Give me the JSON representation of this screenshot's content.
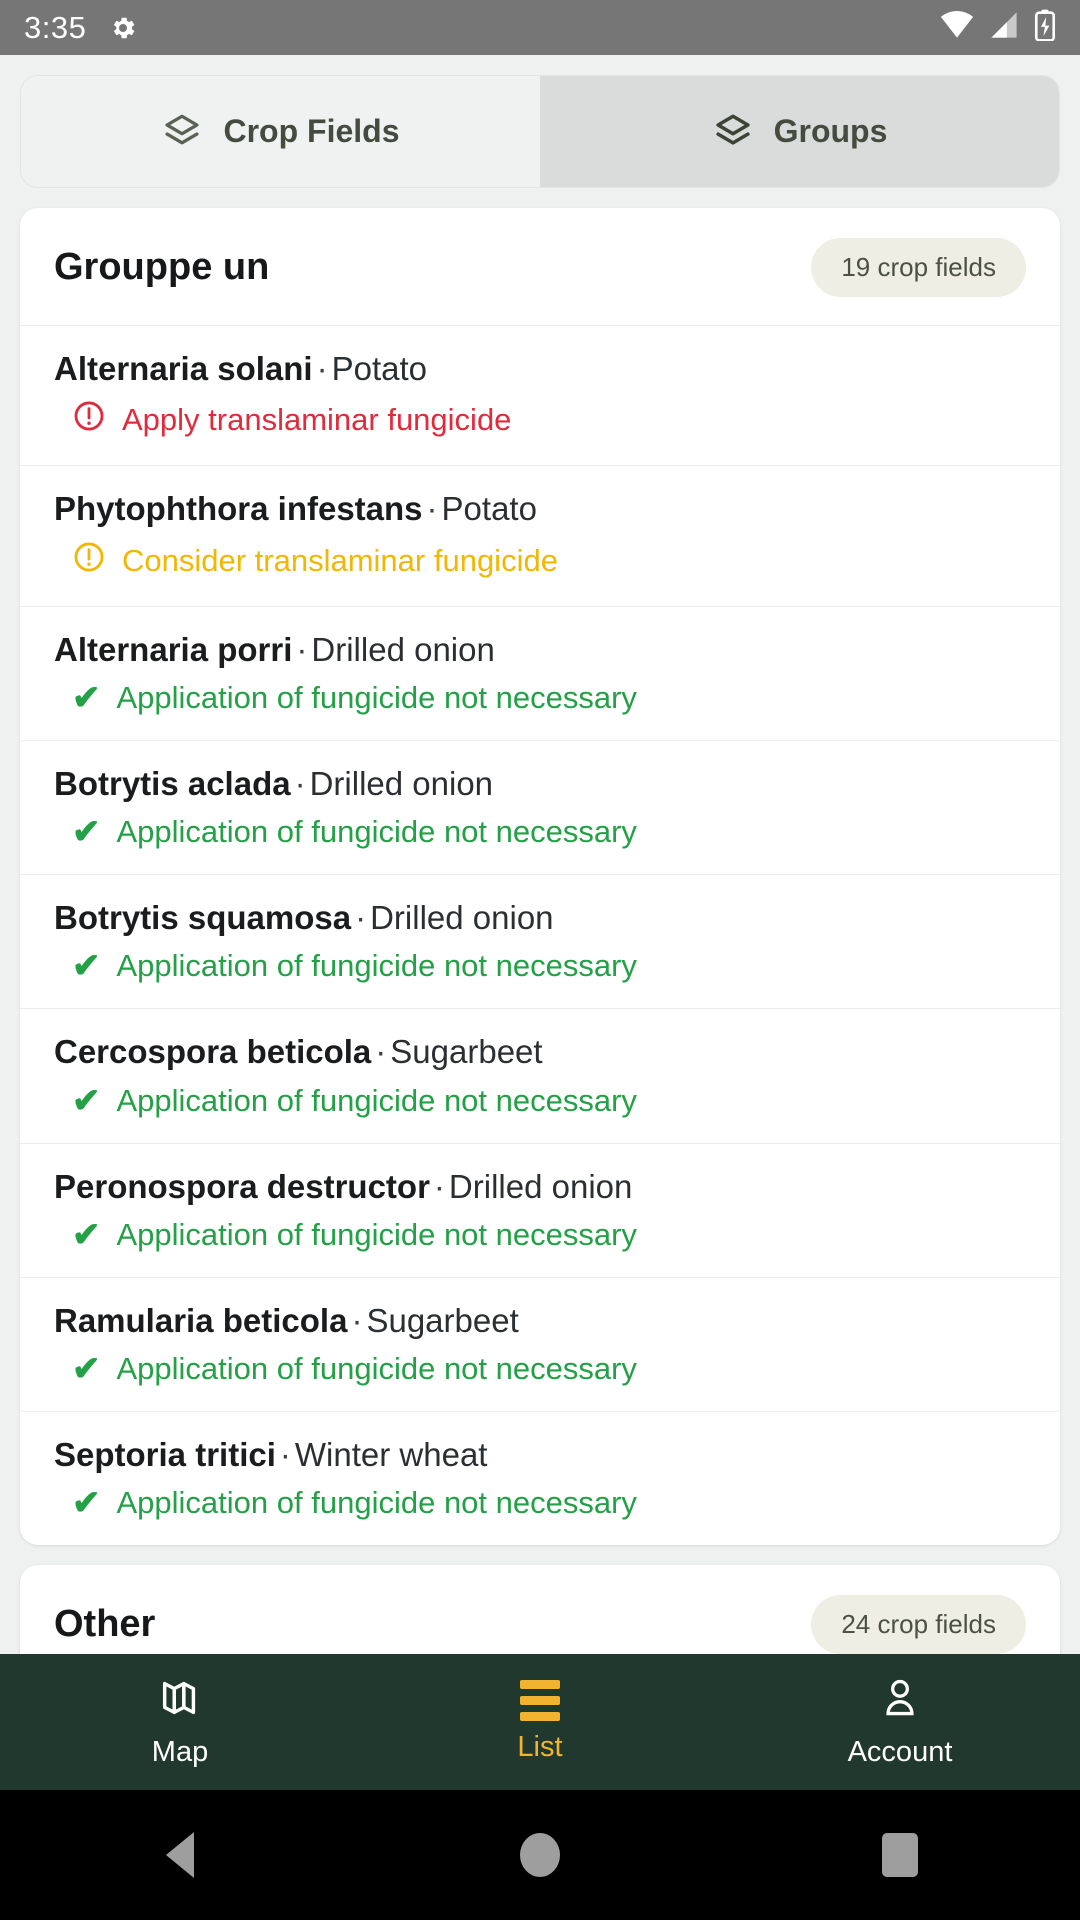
{
  "status_bar": {
    "time": "3:35",
    "icons": [
      "gear-icon",
      "wifi-icon",
      "cellular-signal-icon",
      "battery-charging-icon"
    ]
  },
  "tabs": [
    {
      "label": "Crop Fields",
      "icon": "layers-icon",
      "selected": false
    },
    {
      "label": "Groups",
      "icon": "layers-icon",
      "selected": true
    }
  ],
  "groups": [
    {
      "title": "Grouppe un",
      "badge": "19 crop fields",
      "rows": [
        {
          "pathogen": "Alternaria solani",
          "crop": "Potato",
          "status": "Apply translaminar fungicide",
          "level": "alert",
          "icon": "alert-circle-icon"
        },
        {
          "pathogen": "Phytophthora infestans",
          "crop": "Potato",
          "status": "Consider translaminar fungicide",
          "level": "warn",
          "icon": "warning-circle-icon"
        },
        {
          "pathogen": "Alternaria porri",
          "crop": "Drilled onion",
          "status": "Application of fungicide not necessary",
          "level": "ok",
          "icon": "check-icon"
        },
        {
          "pathogen": "Botrytis aclada",
          "crop": "Drilled onion",
          "status": "Application of fungicide not necessary",
          "level": "ok",
          "icon": "check-icon"
        },
        {
          "pathogen": "Botrytis squamosa",
          "crop": "Drilled onion",
          "status": "Application of fungicide not necessary",
          "level": "ok",
          "icon": "check-icon"
        },
        {
          "pathogen": "Cercospora beticola",
          "crop": "Sugarbeet",
          "status": "Application of fungicide not necessary",
          "level": "ok",
          "icon": "check-icon"
        },
        {
          "pathogen": "Peronospora destructor",
          "crop": "Drilled onion",
          "status": "Application of fungicide not necessary",
          "level": "ok",
          "icon": "check-icon"
        },
        {
          "pathogen": "Ramularia beticola",
          "crop": "Sugarbeet",
          "status": "Application of fungicide not necessary",
          "level": "ok",
          "icon": "check-icon"
        },
        {
          "pathogen": "Septoria tritici",
          "crop": "Winter wheat",
          "status": "Application of fungicide not necessary",
          "level": "ok",
          "icon": "check-icon"
        }
      ]
    },
    {
      "title": "Other",
      "badge": "24 crop fields",
      "rows": []
    }
  ],
  "bottom_nav": [
    {
      "label": "Map",
      "icon": "map-icon",
      "active": false
    },
    {
      "label": "List",
      "icon": "list-icon",
      "active": true
    },
    {
      "label": "Account",
      "icon": "person-icon",
      "active": false
    }
  ],
  "system_nav": [
    {
      "name": "back-button",
      "icon": "triangle-back-icon"
    },
    {
      "name": "home-button",
      "icon": "circle-home-icon"
    },
    {
      "name": "recents-button",
      "icon": "square-recents-icon"
    }
  ],
  "colors": {
    "status_bar_bg": "#767676",
    "tab_selected_bg": "#d9dcda",
    "nav_bg": "#20382e",
    "accent": "#f2b430",
    "ok": "#24a047",
    "warn": "#f2b705",
    "alert": "#e02b3c",
    "badge_bg": "#eeeee4"
  }
}
